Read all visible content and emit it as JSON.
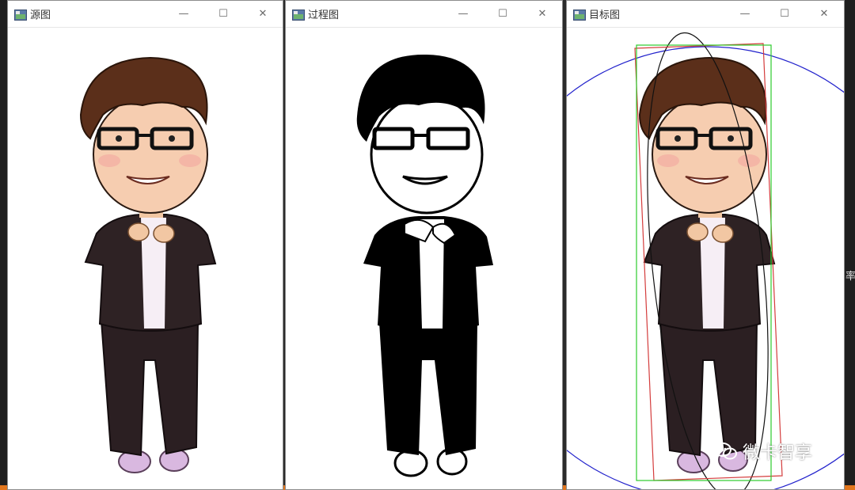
{
  "windows": [
    {
      "title": "源图"
    },
    {
      "title": "过程图"
    },
    {
      "title": "目标图"
    }
  ],
  "window_controls": {
    "minimize": "—",
    "maximize": "☐",
    "close": "✕"
  },
  "watermark": {
    "text": "微卡智享"
  },
  "edge_text": {
    "right_side_glyph": "率"
  },
  "colors": {
    "circle": "#2222cc",
    "rotated_rect": "#d43c3c",
    "bounding_rect": "#2ccc2c",
    "ellipse": "#111111",
    "taskbar_accent": "#e2761d"
  }
}
